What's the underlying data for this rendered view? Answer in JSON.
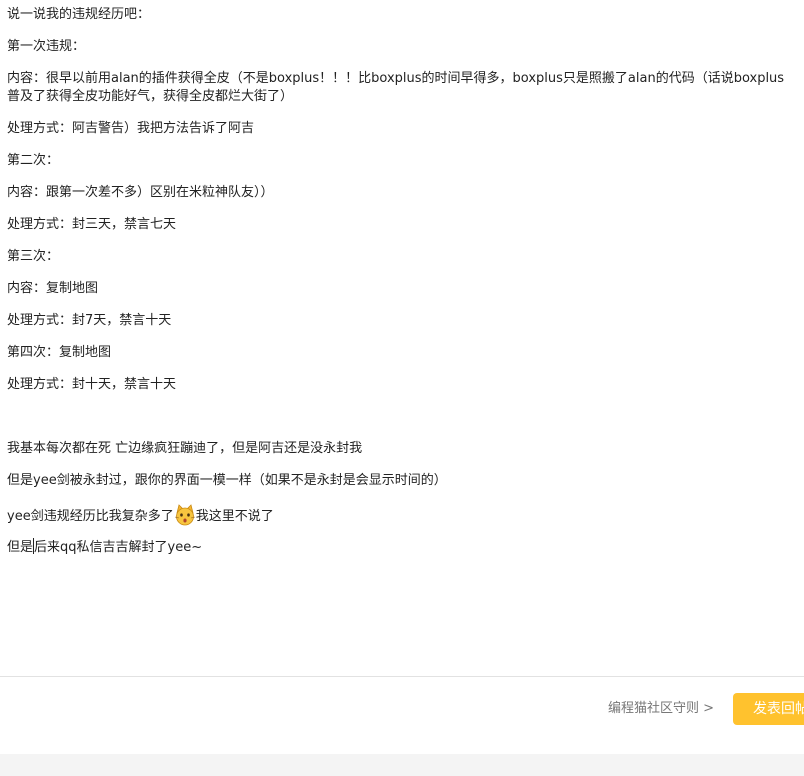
{
  "post": {
    "lines": [
      "说一说我的违规经历吧：",
      "第一次违规：",
      "内容：很早以前用alan的插件获得全皮（不是boxplus！！！比boxplus的时间早得多，boxplus只是照搬了alan的代码（话说boxplus普及了获得全皮功能好气，获得全皮都烂大街了）",
      "处理方式：阿吉警告）我把方法告诉了阿吉",
      "第二次：",
      "内容：跟第一次差不多）区别在米粒神队友））",
      "处理方式：封三天，禁言七天",
      "第三次：",
      "内容：复制地图",
      "处理方式：封7天，禁言十天",
      "第四次：复制地图",
      "处理方式：封十天，禁言十天",
      "",
      "我基本每次都在死 亡边缘疯狂蹦迪了，但是阿吉还是没永封我",
      "但是yee剑被永封过，跟你的界面一模一样（如果不是永封是会显示时间的）"
    ],
    "emoji_line_before": "yee剑违规经历比我复杂多了",
    "emoji_name": "cat-face-emoji",
    "emoji_line_after": "我这里不说了",
    "last_line_before_caret": "但是",
    "last_line_after_caret": "后来qq私信吉吉解封了yee~"
  },
  "bottom_bar": {
    "rules_link": "编程猫社区守则 >",
    "submit_label": "发表回帖"
  },
  "colors": {
    "accent": "#ffc22e",
    "text": "#222222",
    "muted": "#777777"
  }
}
